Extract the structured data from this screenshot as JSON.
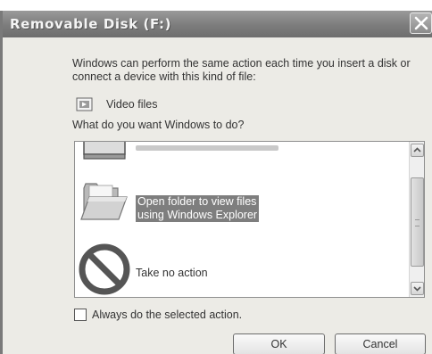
{
  "window": {
    "title": "Removable Disk (F:)"
  },
  "dialog": {
    "intro": "Windows can perform the same action each time you insert a disk or connect a device with this kind of file:",
    "file_type": "Video files",
    "question": "What do you want Windows to do?",
    "actions": [
      {
        "icon": "partial-item-icon",
        "label": ""
      },
      {
        "icon": "folder-icon",
        "label_line1": "Open folder to view files",
        "label_line2": "using Windows Explorer",
        "selected": true
      },
      {
        "icon": "no-action-icon",
        "label": "Take no action"
      }
    ],
    "always_label": "Always do the selected action.",
    "always_checked": false,
    "ok_label": "OK",
    "cancel_label": "Cancel"
  },
  "colors": {
    "title_bar": "#7c7c7c",
    "dialog_bg": "#ecebe6",
    "selection": "#7e7e7e"
  }
}
